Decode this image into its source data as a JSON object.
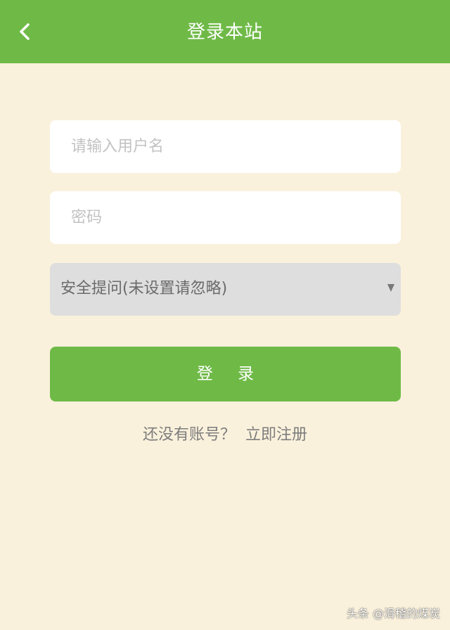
{
  "header": {
    "title": "登录本站",
    "back_icon": "chevron-left-icon"
  },
  "form": {
    "username_placeholder": "请输入用户名",
    "password_placeholder": "密码",
    "security_question": {
      "selected": "安全提问(未设置请忽略)",
      "arrow_icon": "triangle-down-icon"
    },
    "login_label": "登 录",
    "register_prompt": "还没有账号？",
    "register_link": "立即注册"
  },
  "watermark": "头条 @滑稽的煤炭",
  "colors": {
    "accent": "#6fba47",
    "background": "#faf1dc",
    "select_bg": "#dedede"
  }
}
